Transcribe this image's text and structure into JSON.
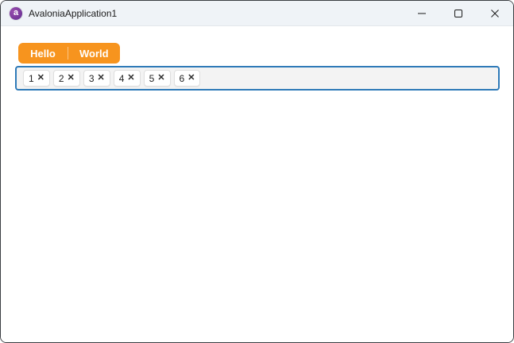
{
  "window": {
    "title": "AvaloniaApplication1",
    "logo_glyph": "a",
    "icons": {
      "app": "avalonia-logo-icon",
      "minimize": "minimize-icon",
      "maximize": "maximize-icon",
      "close": "close-icon"
    }
  },
  "tabs": {
    "items": [
      {
        "label": "Hello"
      },
      {
        "label": "World"
      }
    ]
  },
  "tagbox": {
    "remove_glyph": "✕",
    "chips": [
      {
        "label": "1"
      },
      {
        "label": "2"
      },
      {
        "label": "3"
      },
      {
        "label": "4"
      },
      {
        "label": "5"
      },
      {
        "label": "6"
      }
    ]
  },
  "colors": {
    "accent_orange": "#F7941E",
    "focus_border_blue": "#2E7AB8",
    "titlebar_bg": "#EFF3F7",
    "logo_purple": "#7C3A9D",
    "tagbox_bg": "#F3F3F3",
    "window_border": "#3A3D41"
  }
}
